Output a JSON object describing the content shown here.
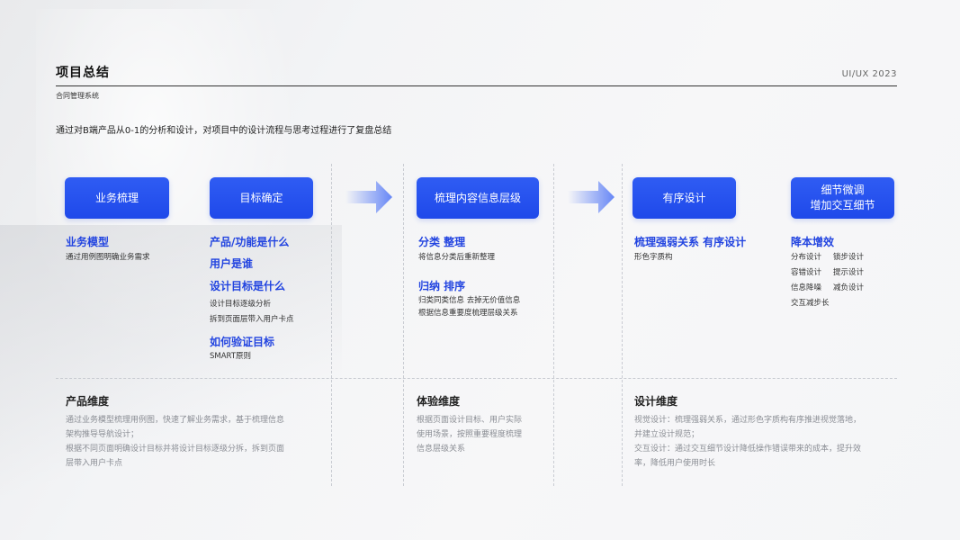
{
  "header": {
    "title": "项目总结",
    "subtitle": "合同管理系统",
    "tag": "UI/UX 2023",
    "intro": "通过对B端产品从0-1的分析和设计，对项目中的设计流程与思考过程进行了复盘总结"
  },
  "steps": [
    {
      "label": "业务梳理"
    },
    {
      "label": "目标确定"
    },
    {
      "label": "梳理内容信息层级"
    },
    {
      "label": "有序设计"
    },
    {
      "label_line1": "细节微调",
      "label_line2": "增加交互细节"
    }
  ],
  "col1": {
    "heading": "业务模型",
    "desc": "通过用例图明确业务需求"
  },
  "col2": {
    "heading1": "产品/功能是什么",
    "heading2": "用户是谁",
    "heading3": "设计目标是什么",
    "desc3a": "设计目标逐级分析",
    "desc3b": "拆到页面层带入用户卡点",
    "heading4": "如何验证目标",
    "desc4": "SMART原则"
  },
  "col3": {
    "heading1": "分类  整理",
    "desc1": "将信息分类后重新整理",
    "heading2": "归纳   排序",
    "desc2a": "归类同类信息 去掉无价值信息",
    "desc2b": "根据信息重要度梳理层级关系"
  },
  "col4": {
    "heading": "梳理强弱关系 有序设计",
    "desc": "形色字质构"
  },
  "col5": {
    "heading": "降本增效",
    "items": [
      "分布设计",
      "锁步设计",
      "容错设计",
      "提示设计",
      "信息降噪",
      "减负设计",
      "交互减步长"
    ]
  },
  "sections": {
    "product": {
      "title": "产品维度",
      "line1": "通过业务模型梳理用例图，快速了解业务需求，基于梳理信息",
      "line2": "架构推导导航设计；",
      "line3": "根据不同页面明确设计目标并将设计目标逐级分拆，拆到页面",
      "line4": "层带入用户卡点"
    },
    "experience": {
      "title": "体验维度",
      "line1": "根据页面设计目标、用户实际",
      "line2": "使用场景，按照重要程度梳理",
      "line3": "信息层级关系"
    },
    "design": {
      "title": "设计维度",
      "line1": "视觉设计：梳理强弱关系，通过形色字质构有序推进视觉落地，",
      "line2": "并建立设计规范；",
      "line3": "交互设计：通过交互细节设计降低操作错误带来的成本，提升效",
      "line4": "率，降低用户使用时长"
    }
  },
  "colors": {
    "accent": "#2449ea",
    "heading_blue": "#2244e0",
    "muted_text": "#8a8d94"
  },
  "icons": {
    "arrow": "arrow-right-icon"
  }
}
